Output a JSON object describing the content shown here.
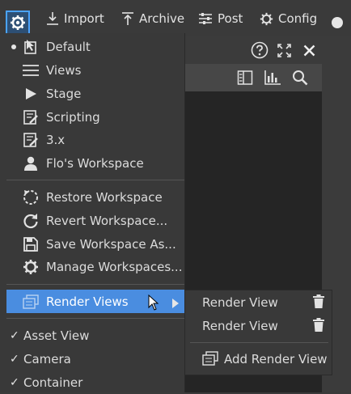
{
  "toolbar": {
    "import_label": "Import",
    "archive_label": "Archive",
    "post_label": "Post",
    "config_label": "Config"
  },
  "menu": {
    "workspaces": [
      {
        "label": "Default",
        "icon": "default-workspace-icon",
        "active": true
      },
      {
        "label": "Views",
        "icon": "views-icon"
      },
      {
        "label": "Stage",
        "icon": "play-icon"
      },
      {
        "label": "Scripting",
        "icon": "scripting-icon"
      },
      {
        "label": "3.x",
        "icon": "scripting-icon"
      },
      {
        "label": "Flo's Workspace",
        "icon": "user-icon"
      }
    ],
    "actions": [
      {
        "label": "Restore Workspace",
        "icon": "restore-icon"
      },
      {
        "label": "Revert Workspace...",
        "icon": "revert-icon"
      },
      {
        "label": "Save Workspace As...",
        "icon": "save-icon"
      },
      {
        "label": "Manage Workspaces...",
        "icon": "gear-icon"
      }
    ],
    "render_views_label": "Render Views",
    "checked_views": [
      {
        "label": "Asset View",
        "checked": true
      },
      {
        "label": "Camera",
        "checked": true
      },
      {
        "label": "Container",
        "checked": true
      }
    ]
  },
  "submenu": {
    "items": [
      {
        "label": "Render View"
      },
      {
        "label": "Render View"
      }
    ],
    "add_label": "Add Render View"
  },
  "colors": {
    "highlight": "#4a8de0",
    "accent_border": "#4aa3ff"
  }
}
